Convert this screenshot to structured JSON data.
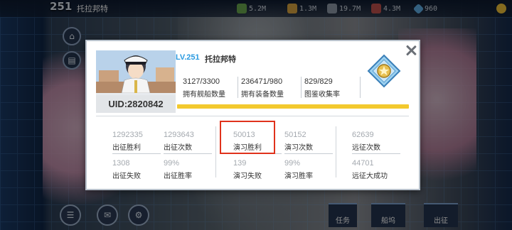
{
  "topbar": {
    "level": "251",
    "player_name": "托拉邦特",
    "resources": [
      {
        "icon": "oil-icon",
        "value": "5.2M",
        "color": "#6aa84f"
      },
      {
        "icon": "ammo-icon",
        "value": "1.3M",
        "color": "#d9a441"
      },
      {
        "icon": "steel-icon",
        "value": "19.7M",
        "color": "#8e9aa8"
      },
      {
        "icon": "aluminum-icon",
        "value": "4.3M",
        "color": "#c0504d"
      },
      {
        "icon": "diamond-icon",
        "value": "960",
        "color": "#5fb0e8"
      }
    ]
  },
  "bottom": {
    "tab_task": "任务",
    "tab_dock": "船坞",
    "tab_sortie": "出征"
  },
  "profile": {
    "level": "LV.251",
    "name": "托拉邦特",
    "uid": "UID:2820842",
    "top_stats": [
      {
        "value": "3127/3300",
        "label": "拥有舰船数量"
      },
      {
        "value": "236471/980",
        "label": "拥有装备数量"
      },
      {
        "value": "829/829",
        "label": "图鉴收集率"
      }
    ],
    "stats": {
      "sortie_wins": {
        "value": "1292335",
        "label": "出征胜利"
      },
      "sortie_count": {
        "value": "1293643",
        "label": "出征次数"
      },
      "sortie_losses": {
        "value": "1308",
        "label": "出征失败"
      },
      "sortie_rate": {
        "value": "99%",
        "label": "出征胜率"
      },
      "exercise_wins": {
        "value": "50013",
        "label": "演习胜利"
      },
      "exercise_count": {
        "value": "50152",
        "label": "演习次数"
      },
      "exercise_losses": {
        "value": "139",
        "label": "演习失败"
      },
      "exercise_rate": {
        "value": "99%",
        "label": "演习胜率"
      },
      "expedition_count": {
        "value": "62639",
        "label": "远征次数"
      },
      "expedition_great": {
        "value": "44701",
        "label": "远征大成功"
      }
    }
  },
  "colors": {
    "accent_blue": "#2a9ae0",
    "progress_yellow": "#f3c92e",
    "highlight_red": "#e0321c"
  }
}
